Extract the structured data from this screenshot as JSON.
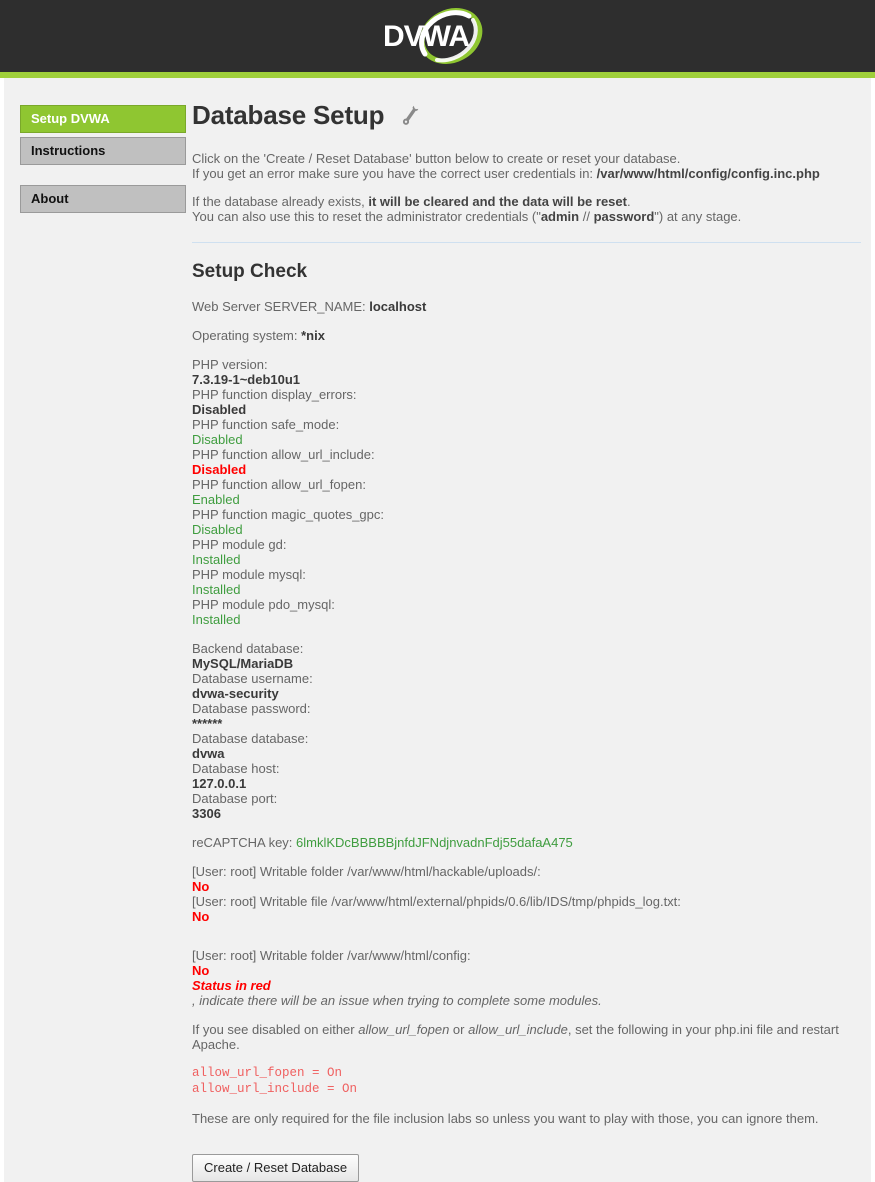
{
  "header": {
    "logo_text": "DVWA",
    "logo_alt": "dvwa-logo",
    "accent_color": "#9fcf3a",
    "background_color": "#2e2e2e"
  },
  "sidebar": {
    "groups": [
      {
        "items": [
          {
            "label": "Setup DVWA",
            "active": true
          },
          {
            "label": "Instructions",
            "active": false
          }
        ]
      },
      {
        "items": [
          {
            "label": "About",
            "active": false
          }
        ]
      }
    ]
  },
  "main": {
    "page_title": "Database Setup",
    "wrench_icon": "wrench-icon",
    "intro": {
      "line1": "Click on the 'Create / Reset Database' button below to create or reset your database.",
      "line2_prefix": "If you get an error make sure you have the correct user credentials in: ",
      "line2_path": "/var/www/html/config/config.inc.php",
      "line3_prefix": "If the database already exists, ",
      "line3_bold": "it will be cleared and the data will be reset",
      "line3_suffix": ".",
      "line4_prefix": "You can also use this to reset the administrator credentials (\"",
      "line4_admin": "admin",
      "line4_mid": " // ",
      "line4_password": "password",
      "line4_suffix": "\") at any stage."
    },
    "setup_check": {
      "heading": "Setup Check",
      "server_name_label": "Web Server SERVER_NAME: ",
      "server_name_value": "localhost",
      "os_label": "Operating system: ",
      "os_value": "*nix",
      "php_checks": [
        {
          "label": "PHP version: ",
          "value": "7.3.19-1~deb10u1",
          "style": "val"
        },
        {
          "label": "PHP function display_errors: ",
          "value": "Disabled",
          "style": "val"
        },
        {
          "label": "PHP function safe_mode: ",
          "value": "Disabled",
          "style": "ok"
        },
        {
          "label": "PHP function allow_url_include: ",
          "value": "Disabled",
          "style": "bad"
        },
        {
          "label": "PHP function allow_url_fopen: ",
          "value": "Enabled",
          "style": "ok"
        },
        {
          "label": "PHP function magic_quotes_gpc: ",
          "value": "Disabled",
          "style": "ok"
        },
        {
          "label": "PHP module gd: ",
          "value": "Installed",
          "style": "ok"
        },
        {
          "label": "PHP module mysql: ",
          "value": "Installed",
          "style": "ok"
        },
        {
          "label": "PHP module pdo_mysql: ",
          "value": "Installed",
          "style": "ok"
        }
      ],
      "database_checks": [
        {
          "label": "Backend database: ",
          "value": "MySQL/MariaDB",
          "style": "val"
        },
        {
          "label": "Database username: ",
          "value": "dvwa-security",
          "style": "val"
        },
        {
          "label": "Database password: ",
          "value": "******",
          "style": "val"
        },
        {
          "label": "Database database: ",
          "value": "dvwa",
          "style": "val"
        },
        {
          "label": "Database host: ",
          "value": "127.0.0.1",
          "style": "val"
        },
        {
          "label": "Database port: ",
          "value": "3306",
          "style": "val"
        }
      ],
      "recaptcha_label": "reCAPTCHA key: ",
      "recaptcha_value": "6lmklKDcBBBBBjnfdJFNdjnvadnFdj55dafaA475",
      "writable_checks": [
        {
          "label": "[User: root] Writable folder /var/www/html/hackable/uploads/: ",
          "value": "No",
          "style": "bad"
        },
        {
          "label": "[User: root] Writable file /var/www/html/external/phpids/0.6/lib/IDS/tmp/phpids_log.txt: ",
          "value": "No",
          "style": "bad"
        }
      ],
      "config_check": {
        "label": "[User: root] Writable folder /var/www/html/config: ",
        "value": "No",
        "style": "bad"
      },
      "status_red_label": "Status in red",
      "status_red_note": ", indicate there will be an issue when trying to complete some modules."
    },
    "php_ini_help": {
      "line_prefix": "If you see disabled on either ",
      "fn1": "allow_url_fopen",
      "line_mid": " or ",
      "fn2": "allow_url_include",
      "line_suffix": ", set the following in your php.ini file and restart Apache.",
      "code_line1": "allow_url_fopen = On",
      "code_line2": "allow_url_include = On",
      "footer_note": "These are only required for the file inclusion labs so unless you want to play with those, you can ignore them."
    },
    "create_reset_button": "Create / Reset Database"
  }
}
